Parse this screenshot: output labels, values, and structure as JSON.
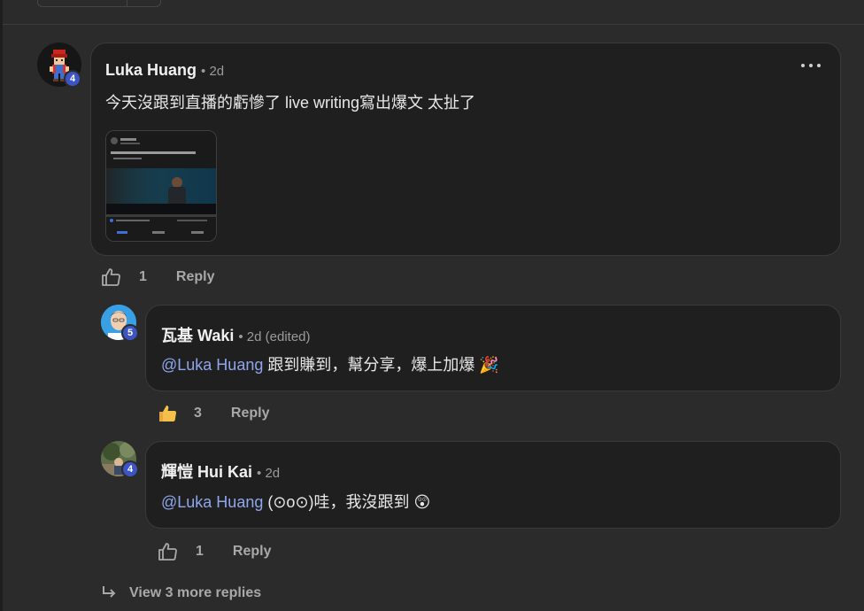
{
  "comments": [
    {
      "author": "Luka Huang",
      "meta": "• 2d",
      "level": "4",
      "text": "今天沒跟到直播的虧慘了 live writing寫出爆文 太扯了",
      "likes": "1",
      "reply_label": "Reply",
      "attachment": {
        "title": "ChatGPT",
        "caption": "【 ... 】"
      }
    },
    {
      "author": "瓦基 Waki",
      "meta": "• 2d (edited)",
      "level": "5",
      "mention": "@Luka Huang",
      "text": " 跟到賺到，幫分享，爆上加爆 🎉",
      "likes": "3",
      "reply_label": "Reply"
    },
    {
      "author": "輝愷 Hui Kai",
      "meta": "• 2d",
      "level": "4",
      "mention": "@Luka Huang",
      "text": " (⊙o⊙)哇，我沒跟到 😲",
      "likes": "1",
      "reply_label": "Reply"
    }
  ],
  "view_more": "View 3 more replies",
  "colors": {
    "background": "#2b2b2b",
    "bubble": "#1f1f1f",
    "mention": "#8ea6ec",
    "badge": "#3d54c4"
  }
}
